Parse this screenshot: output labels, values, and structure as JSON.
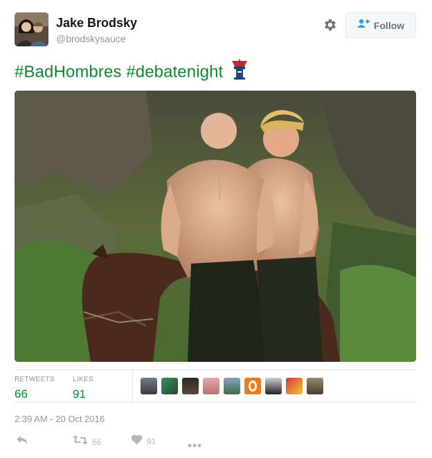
{
  "user": {
    "fullname": "Jake Brodsky",
    "username": "@brodskysauce",
    "avatar_icon": "avatar-photo"
  },
  "header": {
    "gear_icon": "gear-icon",
    "follow_label": "Follow",
    "follow_icon": "follow-person-icon"
  },
  "tweet": {
    "hashtag_1": "#BadHombres",
    "hashtag_2": "#debatenight",
    "emoji_icon": "debate-podium-icon",
    "text_color": "#0c8a2e"
  },
  "stats": {
    "retweets_label": "RETWEETS",
    "retweets_value": "66",
    "likes_label": "LIKES",
    "likes_value": "91"
  },
  "timestamp": "2:39 AM - 20 Oct 2016",
  "actions": {
    "reply_icon": "reply-icon",
    "retweet_icon": "retweet-icon",
    "retweet_count": "66",
    "like_icon": "heart-icon",
    "like_count": "91",
    "more_icon": "more-dots-icon"
  },
  "colors": {
    "accent": "#0c8a2e",
    "muted": "#8899a6",
    "border": "#e1e8ed"
  }
}
